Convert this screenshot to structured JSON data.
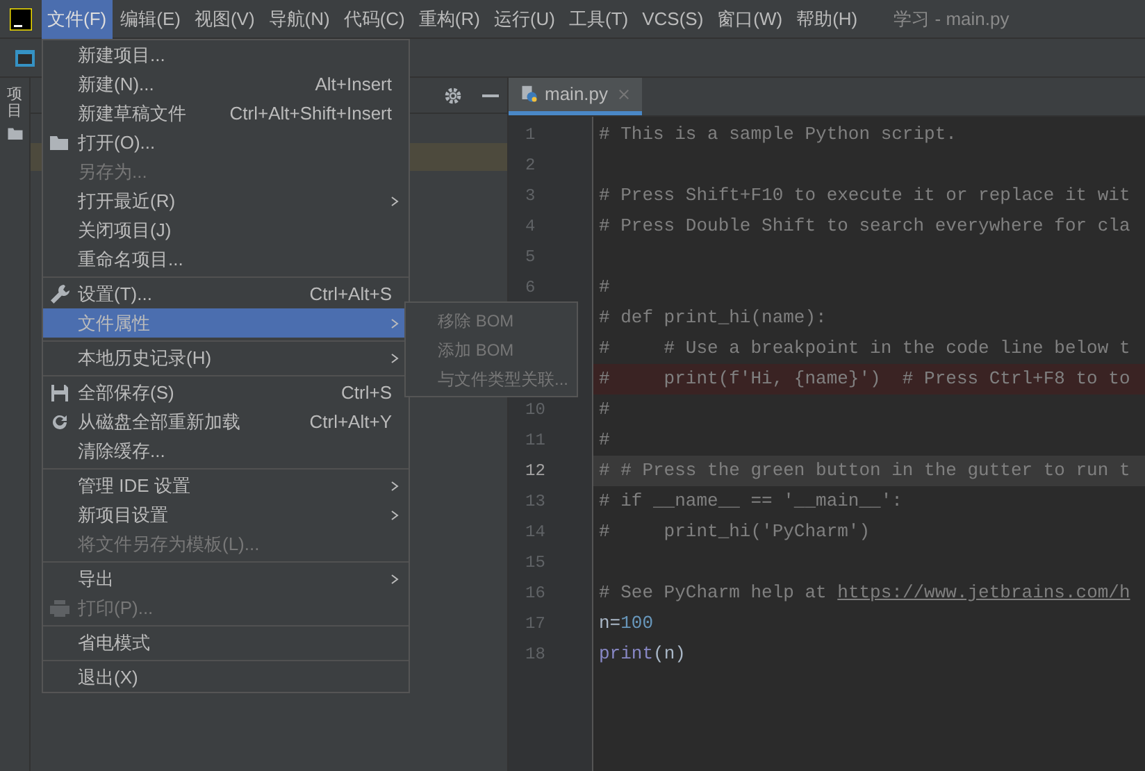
{
  "window": {
    "title": "学习 - main.py"
  },
  "menubar": [
    {
      "label": "文件(F)",
      "selected": true
    },
    {
      "label": "编辑(E)",
      "selected": false
    },
    {
      "label": "视图(V)",
      "selected": false
    },
    {
      "label": "导航(N)",
      "selected": false
    },
    {
      "label": "代码(C)",
      "selected": false
    },
    {
      "label": "重构(R)",
      "selected": false
    },
    {
      "label": "运行(U)",
      "selected": false
    },
    {
      "label": "工具(T)",
      "selected": false
    },
    {
      "label": "VCS(S)",
      "selected": false
    },
    {
      "label": "窗口(W)",
      "selected": false
    },
    {
      "label": "帮助(H)",
      "selected": false
    }
  ],
  "tool_window": {
    "label": "项目"
  },
  "file_menu": [
    {
      "kind": "item",
      "label": "新建项目...",
      "disabled": false,
      "submenu": false,
      "selected": false
    },
    {
      "kind": "item",
      "label": "新建(N)...",
      "shortcut": "Alt+Insert",
      "disabled": false,
      "submenu": false,
      "selected": false
    },
    {
      "kind": "item",
      "label": "新建草稿文件",
      "shortcut": "Ctrl+Alt+Shift+Insert",
      "disabled": false,
      "submenu": false,
      "selected": false
    },
    {
      "kind": "item",
      "label": "打开(O)...",
      "disabled": false,
      "submenu": false,
      "selected": false
    },
    {
      "kind": "item",
      "label": "另存为...",
      "disabled": true,
      "submenu": false,
      "selected": false
    },
    {
      "kind": "item",
      "label": "打开最近(R)",
      "disabled": false,
      "submenu": true,
      "selected": false
    },
    {
      "kind": "item",
      "label": "关闭项目(J)",
      "disabled": false,
      "submenu": false,
      "selected": false
    },
    {
      "kind": "item",
      "label": "重命名项目...",
      "disabled": false,
      "submenu": false,
      "selected": false
    },
    {
      "kind": "separator"
    },
    {
      "kind": "item",
      "label": "设置(T)...",
      "shortcut": "Ctrl+Alt+S",
      "disabled": false,
      "submenu": false,
      "selected": false
    },
    {
      "kind": "item",
      "label": "文件属性",
      "disabled": false,
      "submenu": true,
      "selected": true
    },
    {
      "kind": "separator"
    },
    {
      "kind": "item",
      "label": "本地历史记录(H)",
      "disabled": false,
      "submenu": true,
      "selected": false
    },
    {
      "kind": "separator"
    },
    {
      "kind": "item",
      "label": "全部保存(S)",
      "shortcut": "Ctrl+S",
      "disabled": false,
      "submenu": false,
      "selected": false
    },
    {
      "kind": "item",
      "label": "从磁盘全部重新加载",
      "shortcut": "Ctrl+Alt+Y",
      "disabled": false,
      "submenu": false,
      "selected": false
    },
    {
      "kind": "item",
      "label": "清除缓存...",
      "disabled": false,
      "submenu": false,
      "selected": false
    },
    {
      "kind": "separator"
    },
    {
      "kind": "item",
      "label": "管理 IDE 设置",
      "disabled": false,
      "submenu": true,
      "selected": false
    },
    {
      "kind": "item",
      "label": "新项目设置",
      "disabled": false,
      "submenu": true,
      "selected": false
    },
    {
      "kind": "item",
      "label": "将文件另存为模板(L)...",
      "disabled": true,
      "submenu": false,
      "selected": false
    },
    {
      "kind": "separator"
    },
    {
      "kind": "item",
      "label": "导出",
      "disabled": false,
      "submenu": true,
      "selected": false
    },
    {
      "kind": "item",
      "label": "打印(P)...",
      "disabled": true,
      "submenu": false,
      "selected": false
    },
    {
      "kind": "separator"
    },
    {
      "kind": "item",
      "label": "省电模式",
      "disabled": false,
      "submenu": false,
      "selected": false
    },
    {
      "kind": "separator"
    },
    {
      "kind": "item",
      "label": "退出(X)",
      "disabled": false,
      "submenu": false,
      "selected": false
    }
  ],
  "submenu": [
    {
      "label": "移除 BOM",
      "disabled": true
    },
    {
      "label": "添加 BOM",
      "disabled": true
    },
    {
      "label": "与文件类型关联...",
      "disabled": true
    }
  ],
  "editor": {
    "tab": {
      "label": "main.py",
      "selected": true
    },
    "lines": [
      {
        "number": "1",
        "breakpoint": false,
        "current": false,
        "segments": [
          {
            "kind": "comment",
            "text": "# This is a sample Python script."
          }
        ]
      },
      {
        "number": "2",
        "breakpoint": false,
        "current": false
      },
      {
        "number": "3",
        "breakpoint": false,
        "current": false,
        "segments": [
          {
            "kind": "comment",
            "text": "# Press Shift+F10 to execute it or replace it wit"
          }
        ]
      },
      {
        "number": "4",
        "breakpoint": false,
        "current": false,
        "segments": [
          {
            "kind": "comment",
            "text": "# Press Double Shift to search everywhere for cla"
          }
        ]
      },
      {
        "number": "5",
        "breakpoint": false,
        "current": false
      },
      {
        "number": "6",
        "breakpoint": false,
        "current": false,
        "segments": [
          {
            "kind": "comment",
            "text": "#"
          }
        ]
      },
      {
        "breakpoint": false,
        "current": false,
        "segments": [
          {
            "kind": "comment",
            "text": "# def print_hi(name):"
          }
        ]
      },
      {
        "breakpoint": false,
        "current": false,
        "segments": [
          {
            "kind": "comment",
            "text": "#     # Use a breakpoint in the code line below t"
          }
        ]
      },
      {
        "breakpoint": true,
        "current": false,
        "segments": [
          {
            "kind": "comment",
            "text": "#     print(f'Hi, {name}')  # Press Ctrl+F8 to to"
          }
        ]
      },
      {
        "number": "10",
        "breakpoint": false,
        "current": false,
        "segments": [
          {
            "kind": "comment",
            "text": "#"
          }
        ]
      },
      {
        "number": "11",
        "breakpoint": false,
        "current": false,
        "segments": [
          {
            "kind": "comment",
            "text": "#"
          }
        ]
      },
      {
        "number": "12",
        "breakpoint": false,
        "current": true,
        "segments": [
          {
            "kind": "comment",
            "text": "# # Press the green button in the gutter to run t"
          }
        ]
      },
      {
        "number": "13",
        "breakpoint": false,
        "current": false,
        "segments": [
          {
            "kind": "comment",
            "text": "# if __name__ == '__main__':"
          }
        ]
      },
      {
        "number": "14",
        "breakpoint": false,
        "current": false,
        "segments": [
          {
            "kind": "comment",
            "text": "#     print_hi('PyCharm')"
          }
        ]
      },
      {
        "number": "15",
        "breakpoint": false,
        "current": false
      },
      {
        "number": "16",
        "breakpoint": false,
        "current": false,
        "segments": [
          {
            "kind": "comment",
            "text": "# See PyCharm help at "
          },
          {
            "kind": "link",
            "text": "https://www.jetbrains.com/h"
          }
        ]
      },
      {
        "number": "17",
        "breakpoint": false,
        "current": false,
        "segments": [
          {
            "kind": "text",
            "text": "n="
          },
          {
            "kind": "number",
            "text": "100"
          }
        ]
      },
      {
        "number": "18",
        "breakpoint": false,
        "current": false,
        "segments": [
          {
            "kind": "builtin",
            "text": "print"
          },
          {
            "kind": "text",
            "text": "(n)"
          }
        ]
      }
    ]
  }
}
